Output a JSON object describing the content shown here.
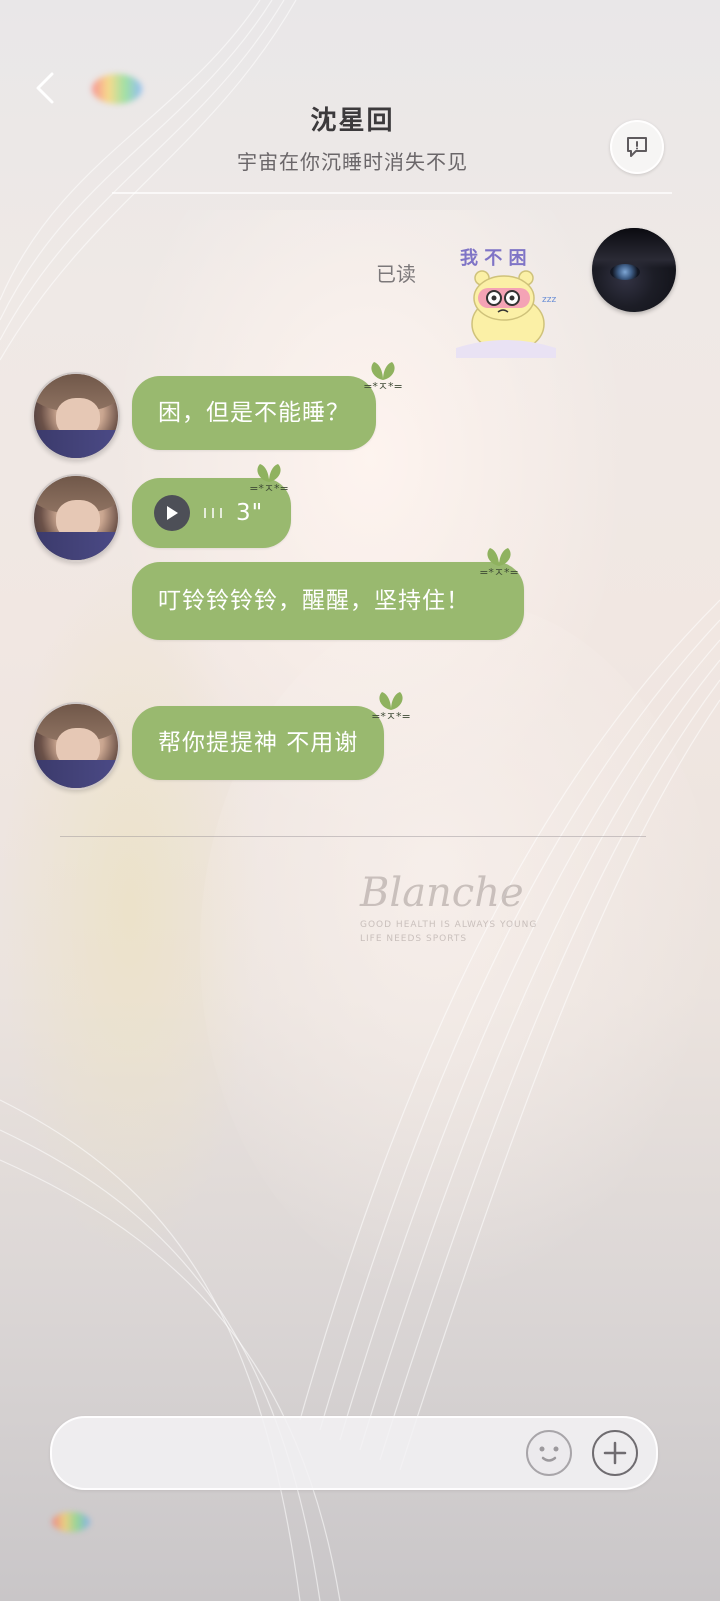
{
  "header": {
    "title": "沈星回",
    "subtitle": "宇宙在你沉睡时消失不见"
  },
  "self_message": {
    "read_status": "已读",
    "sticker_text": "我 不 困"
  },
  "messages": [
    {
      "type": "text",
      "text": "困，但是不能睡？"
    },
    {
      "type": "voice",
      "duration": "3\""
    },
    {
      "type": "text",
      "text": "叮铃铃铃铃，醒醒，坚持住！"
    },
    {
      "type": "text",
      "text": "帮你提提神 不用谢"
    }
  ],
  "bubble_deco_face": "=*ㅈ*=",
  "background_watermark": {
    "brand": "Blanche",
    "tagline_1": "GOOD HEALTH IS ALWAYS YOUNG",
    "tagline_2": "LIFE NEEDS SPORTS"
  },
  "colors": {
    "bubble": "#99b96f",
    "title": "#3c3a3c"
  }
}
